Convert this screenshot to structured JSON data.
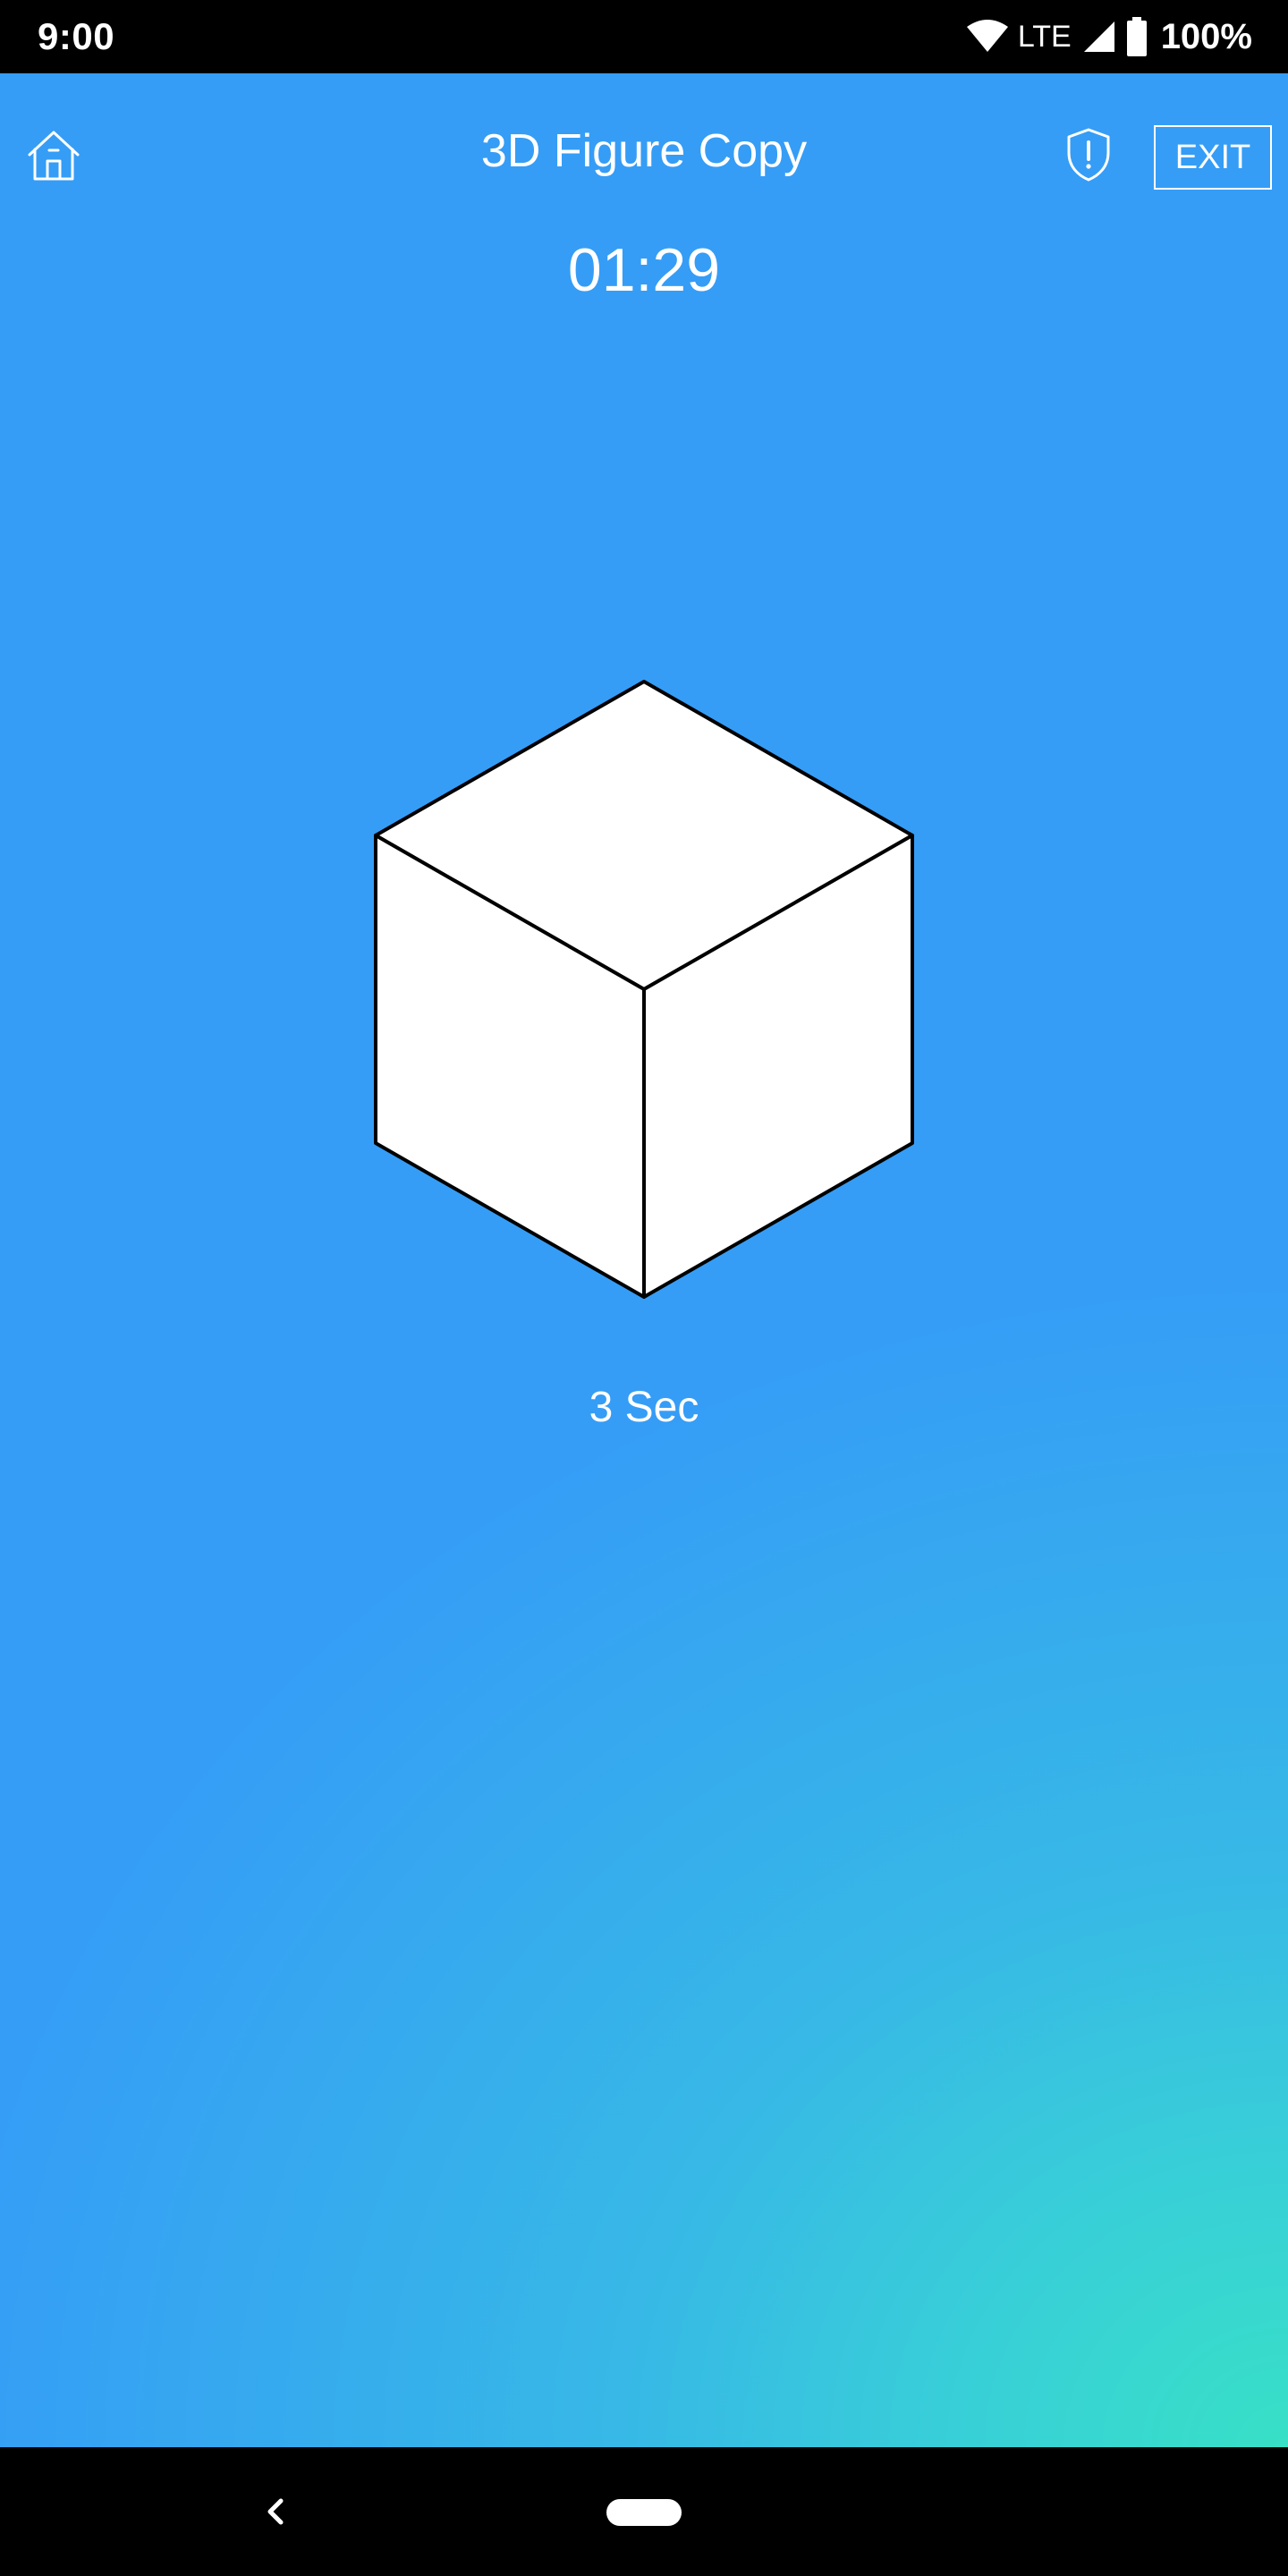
{
  "status_bar": {
    "time": "9:00",
    "network": "LTE",
    "battery": "100%",
    "icons": [
      "wifi-icon",
      "signal-icon",
      "battery-icon"
    ]
  },
  "header": {
    "title": "3D Figure Copy",
    "exit_label": "EXIT",
    "icons": [
      "home-icon",
      "shield-alert-icon"
    ]
  },
  "timer": "01:29",
  "figure": {
    "shape": "cube",
    "fill": "#ffffff",
    "stroke": "#000000"
  },
  "duration_label": "3 Sec",
  "nav_bar": {
    "icons": [
      "back-icon",
      "home-pill-icon"
    ]
  },
  "colors": {
    "background_top": "#359df6",
    "background_bottom_right": "#38e0c6",
    "text": "#ffffff"
  }
}
